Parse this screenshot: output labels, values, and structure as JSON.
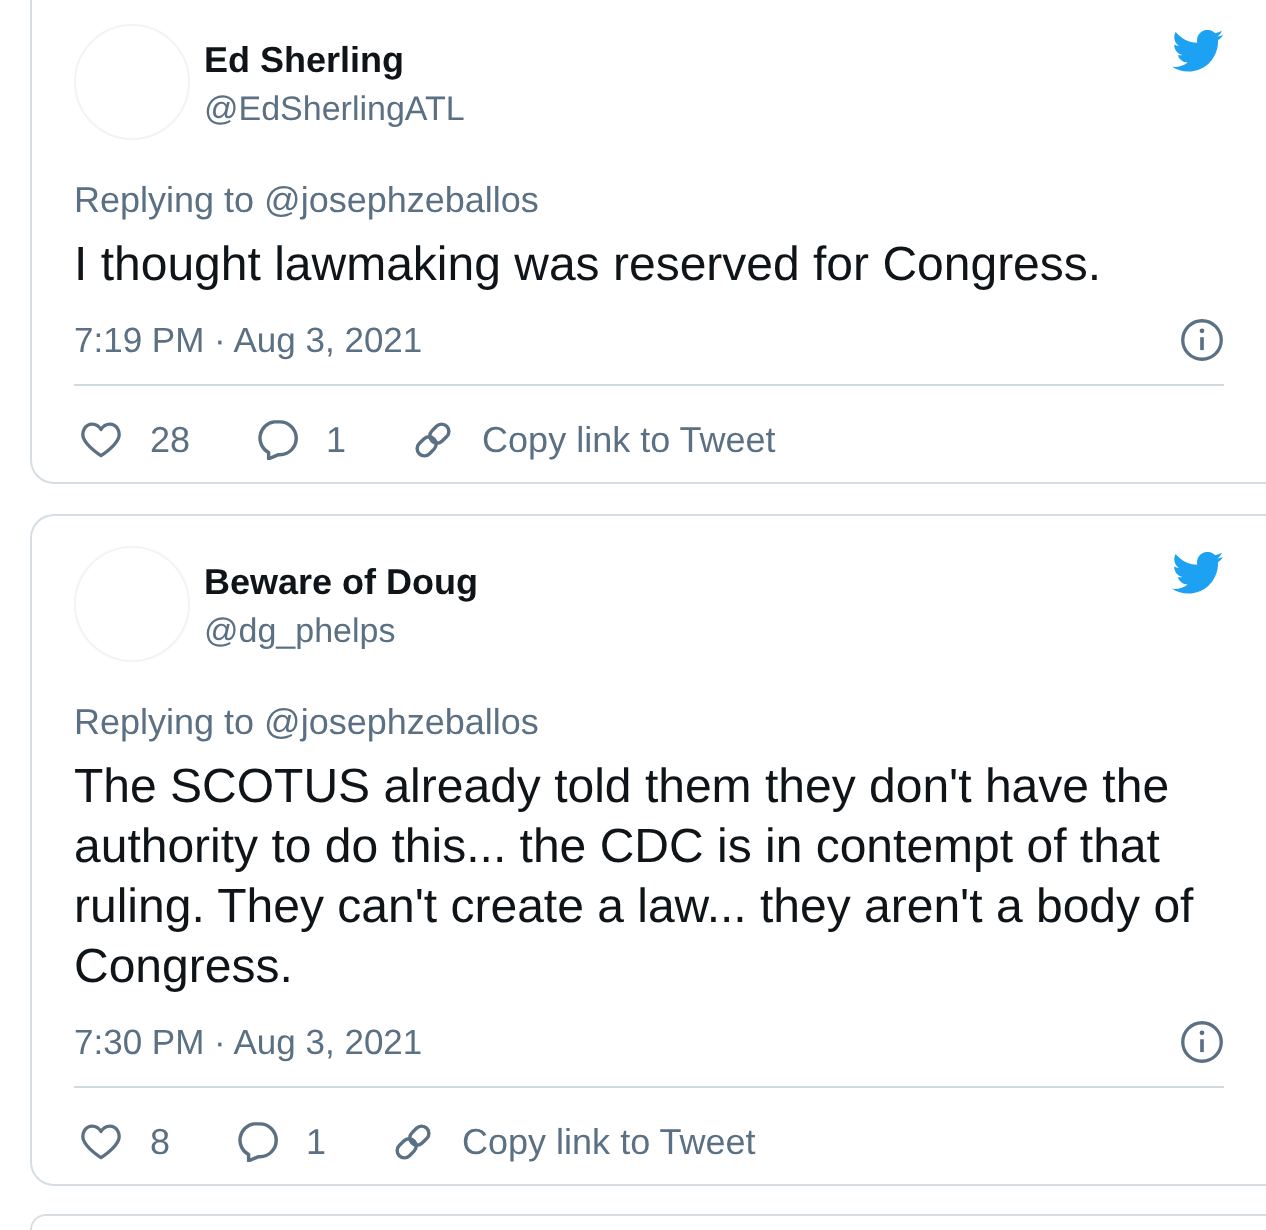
{
  "tweets": [
    {
      "name": "Ed Sherling",
      "handle": "@EdSherlingATL",
      "reply_context": "Replying to @josephzeballos",
      "text": "I thought lawmaking was reserved for Congress.",
      "timestamp": "7:19 PM · Aug 3, 2021",
      "likes": "28",
      "replies": "1",
      "copy_link": "Copy link to Tweet"
    },
    {
      "name": "Beware of Doug",
      "handle": "@dg_phelps",
      "reply_context": "Replying to @josephzeballos",
      "text": "The SCOTUS already told them they don't have the authority to do this... the CDC is in contempt of that ruling. They can't create a law... they aren't a body of Congress.",
      "timestamp": "7:30 PM · Aug 3, 2021",
      "likes": "8",
      "replies": "1",
      "copy_link": "Copy link to Tweet"
    }
  ]
}
